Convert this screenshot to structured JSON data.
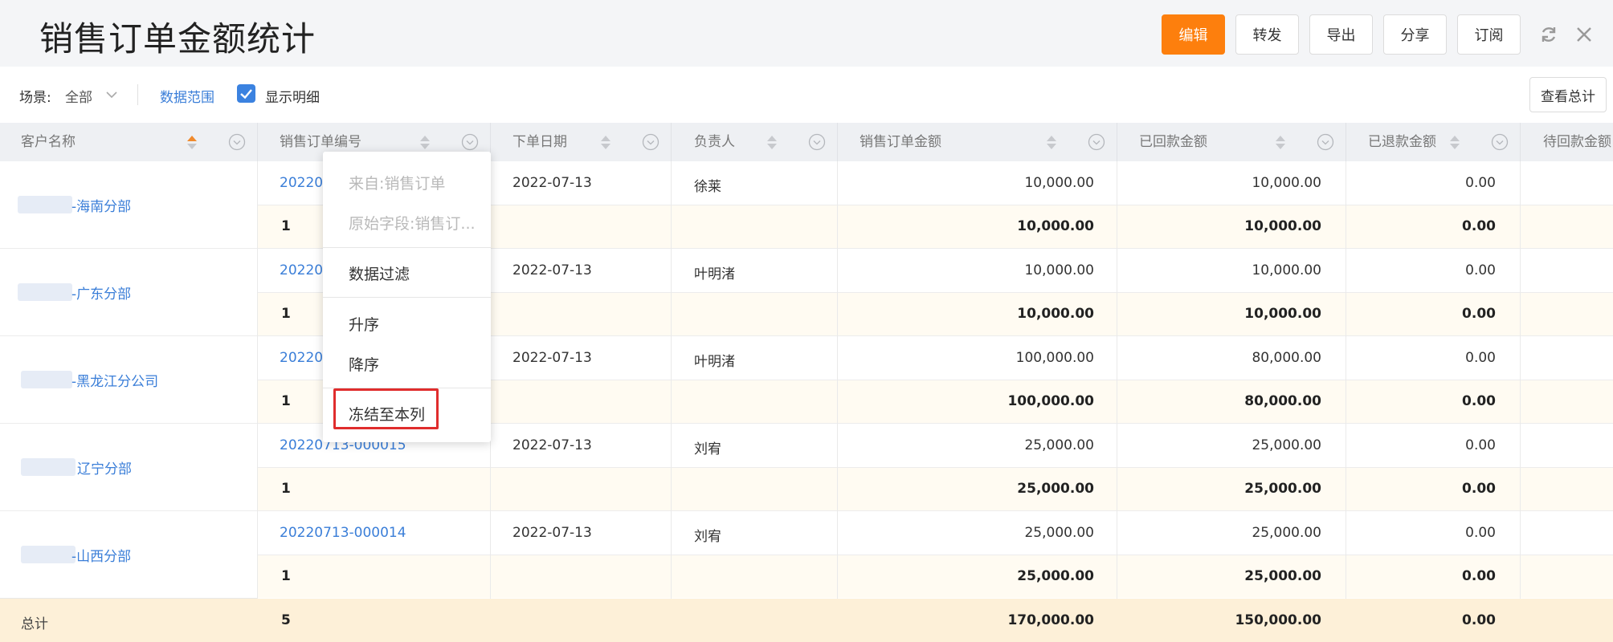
{
  "header": {
    "title": "销售订单金额统计",
    "buttons": {
      "edit": "编辑",
      "forward": "转发",
      "export": "导出",
      "share": "分享",
      "subscribe": "订阅"
    }
  },
  "toolbar": {
    "scene_label": "场景:",
    "scene_value": "全部",
    "data_range": "数据范围",
    "show_detail": "显示明细",
    "show_detail_checked": true,
    "view_total": "查看总计"
  },
  "table": {
    "columns": [
      "客户名称",
      "销售订单编号",
      "下单日期",
      "负责人",
      "销售订单金额",
      "已回款金额",
      "已退款金额",
      "待回款金额"
    ],
    "groups": [
      {
        "customer": "-海南分部",
        "order_no": "202207",
        "date": "2022-07-13",
        "owner": "徐莱",
        "amount": "10,000.00",
        "received": "10,000.00",
        "refund": "0.00",
        "sub_count": "1",
        "sub_amount": "10,000.00",
        "sub_received": "10,000.00",
        "sub_refund": "0.00"
      },
      {
        "customer": "-广东分部",
        "order_no": "202207",
        "date": "2022-07-13",
        "owner": "叶明渚",
        "amount": "10,000.00",
        "received": "10,000.00",
        "refund": "0.00",
        "sub_count": "1",
        "sub_amount": "10,000.00",
        "sub_received": "10,000.00",
        "sub_refund": "0.00"
      },
      {
        "customer": "-黑龙江分公司",
        "order_no": "202207",
        "date": "2022-07-13",
        "owner": "叶明渚",
        "amount": "100,000.00",
        "received": "80,000.00",
        "refund": "0.00",
        "sub_count": "1",
        "sub_amount": "100,000.00",
        "sub_received": "80,000.00",
        "sub_refund": "0.00"
      },
      {
        "customer": "辽宁分部",
        "order_no": "20220713-000015",
        "date": "2022-07-13",
        "owner": "刘宥",
        "amount": "25,000.00",
        "received": "25,000.00",
        "refund": "0.00",
        "sub_count": "1",
        "sub_amount": "25,000.00",
        "sub_received": "25,000.00",
        "sub_refund": "0.00"
      },
      {
        "customer": "-山西分部",
        "order_no": "20220713-000014",
        "date": "2022-07-13",
        "owner": "刘宥",
        "amount": "25,000.00",
        "received": "25,000.00",
        "refund": "0.00",
        "sub_count": "1",
        "sub_amount": "25,000.00",
        "sub_received": "25,000.00",
        "sub_refund": "0.00"
      }
    ],
    "total": {
      "label": "总计",
      "count": "5",
      "amount": "170,000.00",
      "received": "150,000.00",
      "refund": "0.00"
    }
  },
  "context_menu": {
    "items": [
      "来自:销售订单",
      "原始字段:销售订...",
      "数据过滤",
      "升序",
      "降序",
      "冻结至本列"
    ]
  },
  "colors": {
    "primary": "#fd7f0d",
    "link": "#3a7ed8",
    "highlight": "#e02d2d",
    "subtotal_bg": "#fffbf2",
    "total_bg": "#fdf0d8"
  },
  "icons": [
    "refresh-icon",
    "close-icon",
    "chevron-down-icon",
    "check-icon",
    "sort-icon",
    "circle-chevron-icon"
  ]
}
